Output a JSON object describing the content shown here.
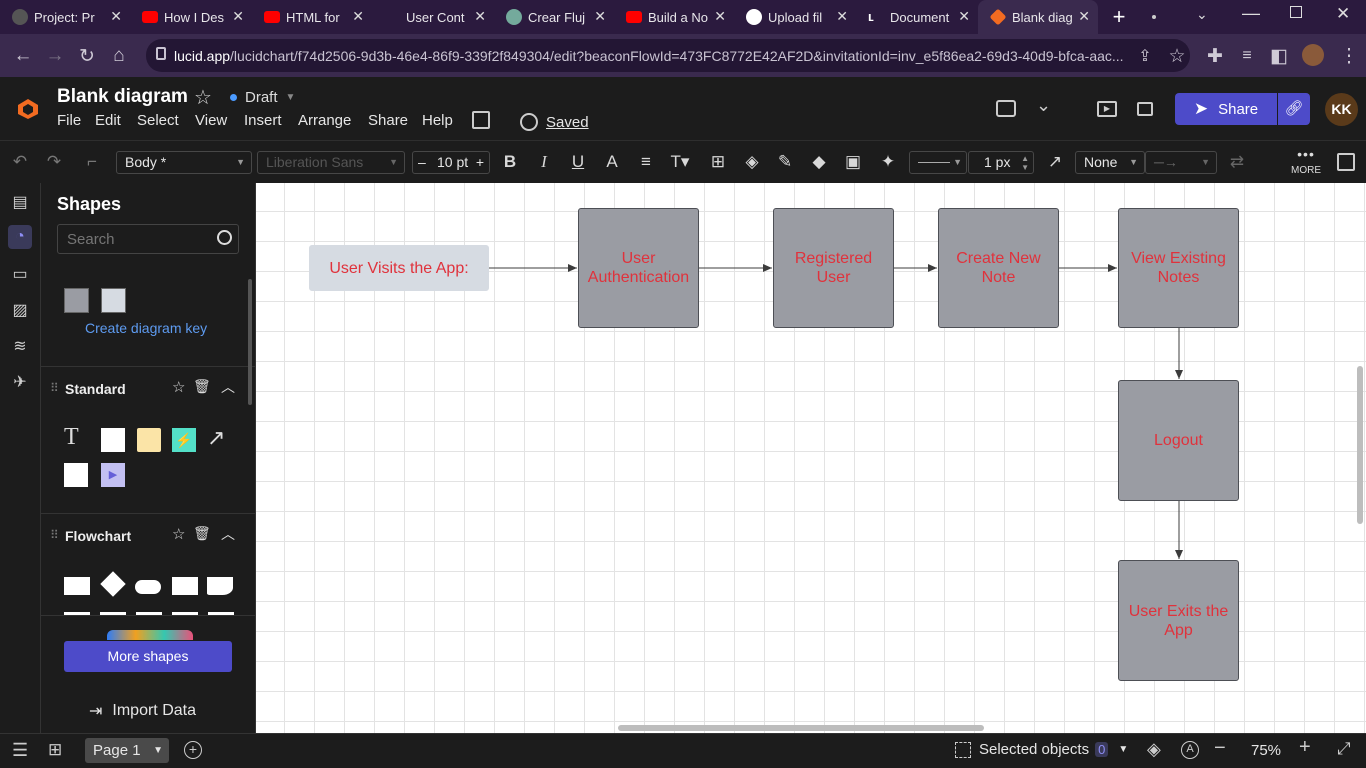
{
  "browser": {
    "tabs": [
      {
        "title": "Project: Pr",
        "icon": "project-tab-icon",
        "color": "#6b6b6b"
      },
      {
        "title": "How I Des",
        "icon": "youtube-icon",
        "color": "#ff0000"
      },
      {
        "title": "HTML for",
        "icon": "youtube-icon",
        "color": "#ff0000"
      },
      {
        "title": "User Cont",
        "icon": "blank-tab-icon",
        "color": "#2b1a3e"
      },
      {
        "title": "Crear Fluj",
        "icon": "chatgpt-icon",
        "color": "#74aa9c"
      },
      {
        "title": "Build a No",
        "icon": "youtube-icon",
        "color": "#ff0000"
      },
      {
        "title": "Upload fil",
        "icon": "github-icon",
        "color": "#ffffff"
      },
      {
        "title": "Document",
        "icon": "doc-icon",
        "color": "#ffffff"
      },
      {
        "title": "Blank diag",
        "icon": "lucid-icon",
        "color": "#f26b21"
      }
    ],
    "url_domain": "lucid.app",
    "url_path": "/lucidchart/f74d2506-9d3b-46e4-86f9-339f2f849304/edit?beaconFlowId=473FC8772E42AF2D&invitationId=inv_e5f86ea2-69d3-40d9-bfca-aac..."
  },
  "app": {
    "title": "Blank diagram",
    "status": "Draft",
    "saved": "Saved",
    "menu": [
      "File",
      "Edit",
      "Select",
      "View",
      "Insert",
      "Arrange",
      "Share",
      "Help"
    ],
    "share_label": "Share",
    "avatar": "KK",
    "brand_color": "#4d4bc9"
  },
  "toolbar": {
    "style": "Body *",
    "font": "Liberation Sans",
    "font_size": "10 pt",
    "line_width": "1 px",
    "arrow_start": "None",
    "more_label": "MORE"
  },
  "panel": {
    "title": "Shapes",
    "search_placeholder": "Search",
    "create_key": "Create diagram key",
    "sections": [
      "Standard",
      "Flowchart"
    ],
    "more_shapes": "More shapes",
    "import_data": "Import Data"
  },
  "diagram": {
    "nodes": [
      {
        "text": "User Visits the App:"
      },
      {
        "text": "User Authentication"
      },
      {
        "text": "Registered User"
      },
      {
        "text": "Create New Note"
      },
      {
        "text": "View Existing Notes"
      },
      {
        "text": "Logout"
      },
      {
        "text": "User Exits the App"
      }
    ]
  },
  "footer": {
    "page": "Page 1",
    "selected_label": "Selected objects",
    "selected_count": "0",
    "zoom": "75%"
  }
}
